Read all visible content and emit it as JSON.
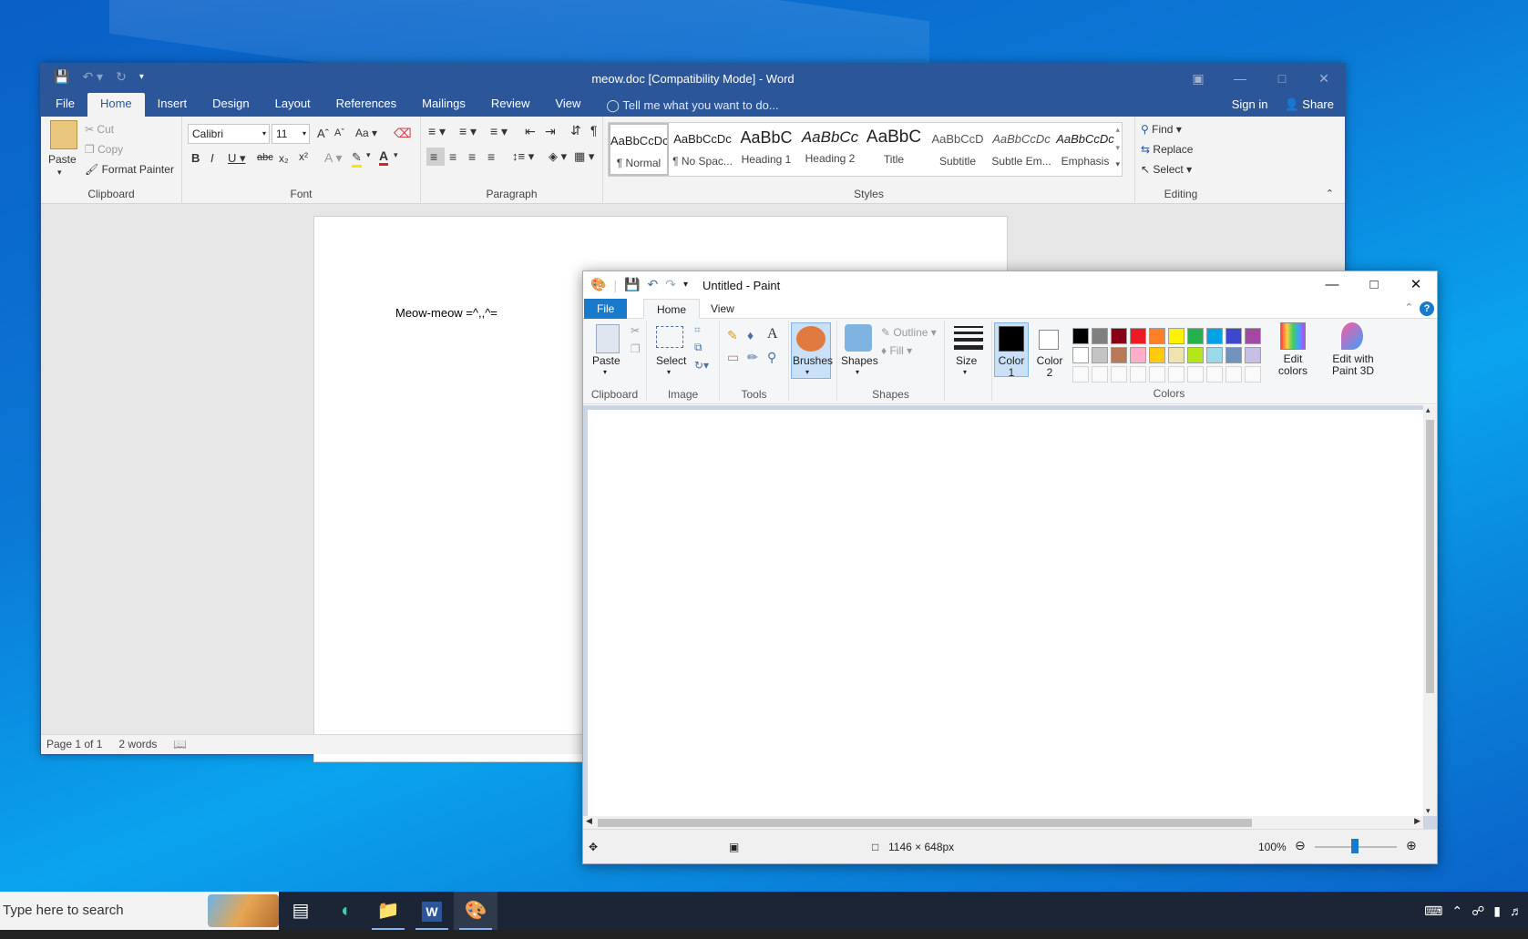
{
  "word": {
    "title": "meow.doc [Compatibility Mode] - Word",
    "qat": {
      "save_icon": "save-icon",
      "undo_icon": "undo-icon",
      "redo_icon": "redo-icon",
      "customize_icon": "chevron-down-icon"
    },
    "tabs": [
      "File",
      "Home",
      "Insert",
      "Design",
      "Layout",
      "References",
      "Mailings",
      "Review",
      "View"
    ],
    "active_tab": "Home",
    "tell_me": "Tell me what you want to do...",
    "sign_in": "Sign in",
    "share": "Share",
    "clipboard": {
      "paste": "Paste",
      "cut": "Cut",
      "copy": "Copy",
      "format_painter": "Format Painter",
      "label": "Clipboard"
    },
    "font": {
      "name": "Calibri",
      "size": "11",
      "case": "Aa",
      "label": "Font"
    },
    "paragraph": {
      "label": "Paragraph"
    },
    "styles": {
      "label": "Styles",
      "items": [
        {
          "preview": "AaBbCcDc",
          "name": "¶ Normal"
        },
        {
          "preview": "AaBbCcDc",
          "name": "¶ No Spac..."
        },
        {
          "preview": "AaBbC",
          "name": "Heading 1"
        },
        {
          "preview": "AaBbCc",
          "name": "Heading 2"
        },
        {
          "preview": "AaBbC",
          "name": "Title"
        },
        {
          "preview": "AaBbCcD",
          "name": "Subtitle"
        },
        {
          "preview": "AaBbCcDc",
          "name": "Subtle Em..."
        },
        {
          "preview": "AaBbCcDc",
          "name": "Emphasis"
        }
      ]
    },
    "editing": {
      "find": "Find",
      "replace": "Replace",
      "select": "Select",
      "label": "Editing"
    },
    "document_text": "Meow-meow =^,,^=",
    "status": {
      "page": "Page 1 of 1",
      "words": "2 words"
    }
  },
  "paint": {
    "title": "Untitled - Paint",
    "tabs": [
      "File",
      "Home",
      "View"
    ],
    "clipboard": {
      "paste": "Paste",
      "label": "Clipboard"
    },
    "image": {
      "select": "Select",
      "label": "Image"
    },
    "tools": {
      "label": "Tools"
    },
    "brushes": "Brushes",
    "shapes": {
      "shapes": "Shapes",
      "outline": "Outline",
      "fill": "Fill",
      "label": "Shapes"
    },
    "size": "Size",
    "color1": "Color 1",
    "color2": "Color 2",
    "colors_label": "Colors",
    "edit_colors": "Edit colors",
    "edit_paint3d": "Edit with Paint 3D",
    "palette_row1": [
      "#000000",
      "#7f7f7f",
      "#880015",
      "#ed1c24",
      "#ff7f27",
      "#fff200",
      "#22b14c",
      "#00a2e8",
      "#3f48cc",
      "#a349a4"
    ],
    "palette_row2": [
      "#ffffff",
      "#c3c3c3",
      "#b97a57",
      "#ffaec9",
      "#ffc90e",
      "#efe4b0",
      "#b5e61d",
      "#99d9ea",
      "#7092be",
      "#c8bfe7"
    ],
    "status": {
      "dimensions": "1146 × 648px",
      "zoom": "100%"
    }
  },
  "taskbar": {
    "search_placeholder": "Type here to search"
  }
}
